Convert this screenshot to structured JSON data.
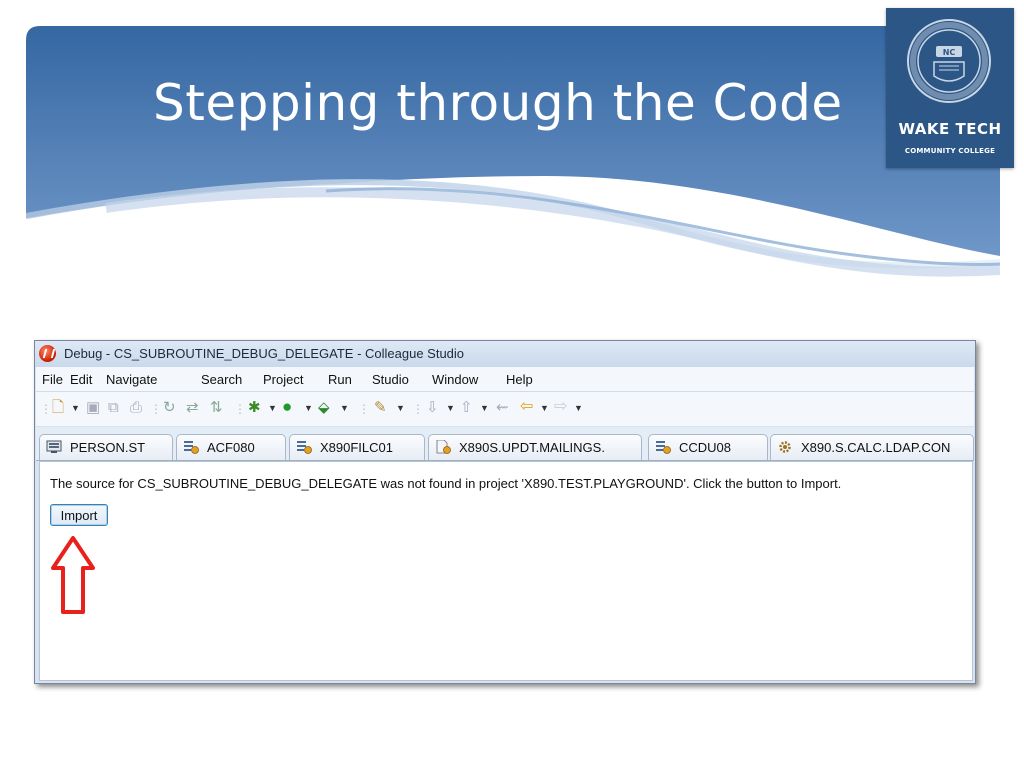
{
  "slide": {
    "title": "Stepping through the Code",
    "logo": {
      "line1": "WAKE TECH",
      "line2": "COMMUNITY COLLEGE",
      "seal_text": "WAKE TECHNICAL COMMUNITY COLLEGE",
      "seal_center": "NC",
      "seal_bottom": "RALEIGH"
    }
  },
  "window": {
    "title": "Debug - CS_SUBROUTINE_DEBUG_DELEGATE - Colleague Studio",
    "app_icon": "colleague-studio-icon"
  },
  "menu": [
    "File",
    "Edit",
    "Navigate",
    "Search",
    "Project",
    "Run",
    "Studio",
    "Window",
    "Help"
  ],
  "toolbar": [
    "new-icon",
    "save-icon",
    "save-all-icon",
    "print-icon",
    "sync-icon",
    "compare-icon",
    "merge-icon",
    "debug-icon",
    "run-icon",
    "external-tools-icon",
    "pin-icon",
    "next-annotation-icon",
    "prev-annotation-icon",
    "last-edit-icon",
    "back-icon",
    "forward-icon"
  ],
  "tabs": [
    {
      "label": "PERSON.ST",
      "icon": "screen-icon"
    },
    {
      "label": "ACF080",
      "icon": "subroutine-icon"
    },
    {
      "label": "X890FILC01",
      "icon": "subroutine-icon"
    },
    {
      "label": "X890S.UPDT.MAILINGS.",
      "icon": "subroutine-doc-icon"
    },
    {
      "label": "CCDU08",
      "icon": "subroutine-icon"
    },
    {
      "label": "X890.S.CALC.LDAP.CON",
      "icon": "gear-icon"
    }
  ],
  "content": {
    "message": "The source for CS_SUBROUTINE_DEBUG_DELEGATE was not found in project 'X890.TEST.PLAYGROUND'. Click the button to Import.",
    "import_button": "Import",
    "annotation": "red-up-arrow-icon"
  },
  "colors": {
    "banner_blue": "#3a6ea8",
    "logo_bg": "#2c5686",
    "arrow_red": "#e8211c",
    "button_border": "#3c7fb1"
  }
}
